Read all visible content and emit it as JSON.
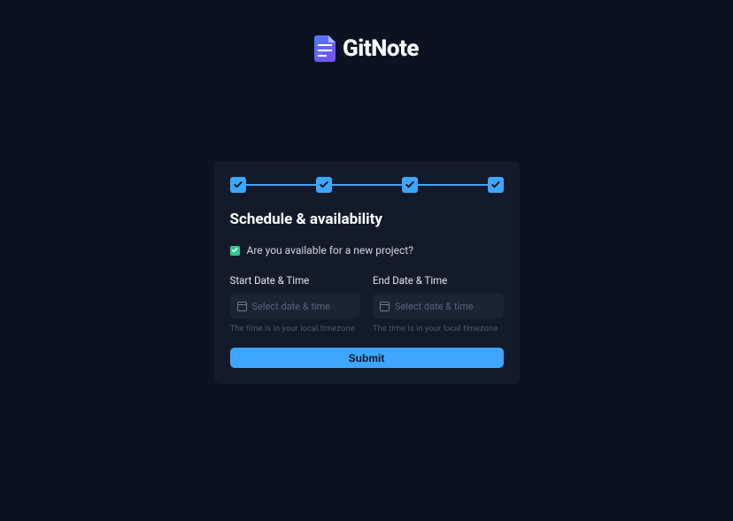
{
  "brand": {
    "name": "GitNote"
  },
  "stepper": {
    "steps": 4,
    "completed": 4
  },
  "form": {
    "title": "Schedule & availability",
    "availability": {
      "checked": true,
      "label": "Are you available for a new project?"
    },
    "start": {
      "label": "Start Date & Time",
      "placeholder": "Select date & time",
      "hint": "The time is in your local timezone"
    },
    "end": {
      "label": "End Date & Time",
      "placeholder": "Select date & time",
      "hint": "The time is in your local timezone"
    },
    "submit_label": "Submit"
  },
  "colors": {
    "accent": "#3ea6ff",
    "success": "#2fc98d",
    "bg": "#0c1222",
    "card": "#131a2a"
  }
}
